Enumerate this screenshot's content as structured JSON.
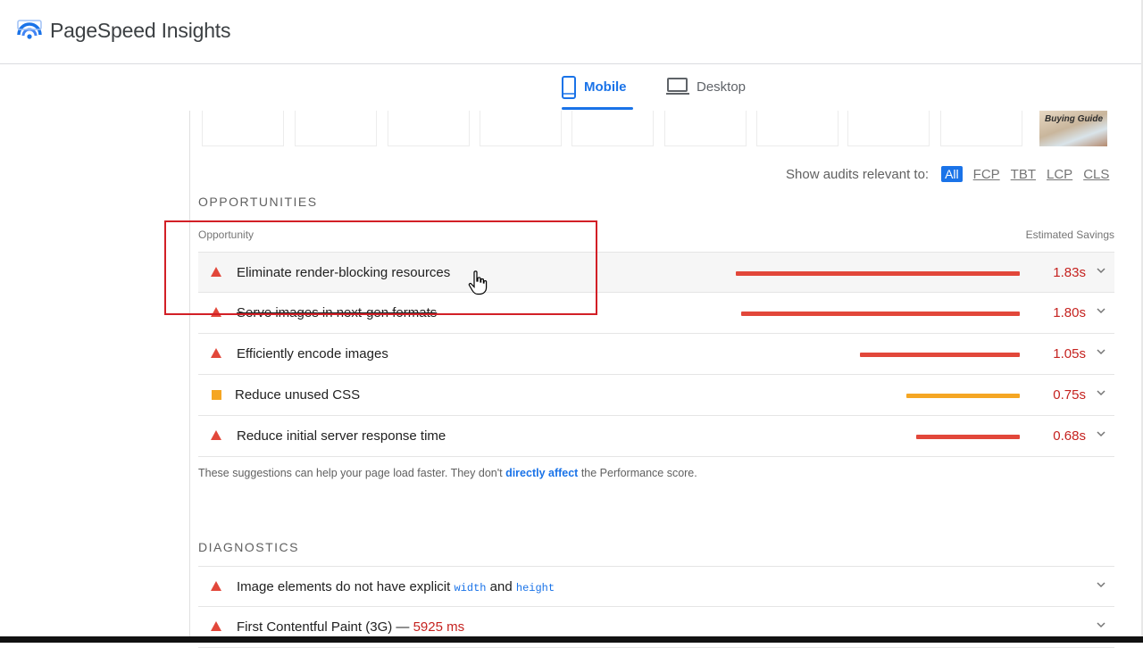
{
  "app": {
    "title": "PageSpeed Insights"
  },
  "tabs": [
    {
      "label": "Mobile",
      "active": true
    },
    {
      "label": "Desktop",
      "active": false
    }
  ],
  "filmstrip": {
    "last_thumb_text": "Buying Guide"
  },
  "audit_filter": {
    "label": "Show audits relevant to:",
    "options": [
      "All",
      "FCP",
      "TBT",
      "LCP",
      "CLS"
    ],
    "selected": "All"
  },
  "opportunities": {
    "section_title": "OPPORTUNITIES",
    "column_opportunity": "Opportunity",
    "column_savings": "Estimated Savings",
    "items": [
      {
        "title": "Eliminate render-blocking resources",
        "savings": "1.83s",
        "severity": "fail",
        "bar_fraction": 0.55
      },
      {
        "title": "Serve images in next-gen formats",
        "savings": "1.80s",
        "severity": "fail",
        "bar_fraction": 0.54
      },
      {
        "title": "Efficiently encode images",
        "savings": "1.05s",
        "severity": "fail",
        "bar_fraction": 0.31
      },
      {
        "title": "Reduce unused CSS",
        "savings": "0.75s",
        "severity": "average",
        "bar_fraction": 0.22
      },
      {
        "title": "Reduce initial server response time",
        "savings": "0.68s",
        "severity": "fail",
        "bar_fraction": 0.2
      }
    ],
    "note_before": "These suggestions can help your page load faster. They don't ",
    "note_link": "directly affect",
    "note_after": " the Performance score."
  },
  "diagnostics": {
    "section_title": "DIAGNOSTICS",
    "items": [
      {
        "title_before": "Image elements do not have explicit ",
        "code1": "width",
        "title_mid": " and ",
        "code2": "height"
      },
      {
        "title_before": "First Contentful Paint (3G)",
        "sep": " — ",
        "value": "5925 ms"
      }
    ]
  },
  "colors": {
    "fail": "#e2473a",
    "average": "#f5a623",
    "accent": "#1a73e8",
    "highlight_box": "#d21f26"
  }
}
